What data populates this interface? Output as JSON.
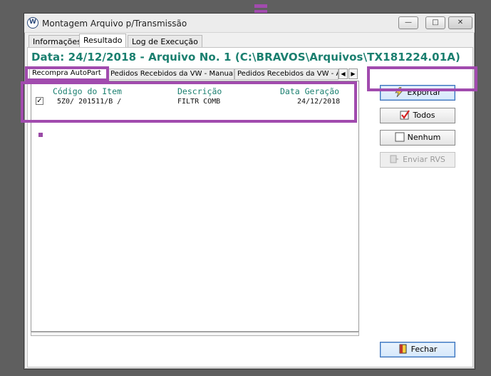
{
  "window": {
    "title": "Montagem Arquivo p/Transmissão",
    "icon": "vw-logo-icon"
  },
  "tabs": [
    {
      "label": "Informações",
      "active": false
    },
    {
      "label": "Resultado",
      "active": true
    },
    {
      "label": "Log de Execução",
      "active": false
    }
  ],
  "header": {
    "text": "Data: 24/12/2018 - Arquivo No. 1   (C:\\BRAVOS\\Arquivos\\TX181224.01A)"
  },
  "subtabs": [
    {
      "label": "Recompra AutoPart",
      "active": true
    },
    {
      "label": "Pedidos Recebidos da VW - Manual",
      "active": false
    },
    {
      "label": "Pedidos Recebidos da VW - Aut",
      "active": false
    }
  ],
  "list": {
    "columns": [
      "Código do Item",
      "Descrição",
      "Data Geração"
    ],
    "rows": [
      {
        "checked": true,
        "codigo": "5Z0/  201511/B /",
        "descricao": "FILTR COMB",
        "data": "24/12/2018"
      }
    ]
  },
  "buttons": {
    "exportar": "Exportar",
    "todos": "Todos",
    "nenhum": "Nenhum",
    "enviar_rvs": "Enviar RVS",
    "fechar": "Fechar"
  },
  "colors": {
    "accent_teal": "#1a7f6f",
    "highlight_purple": "#a14bae"
  }
}
